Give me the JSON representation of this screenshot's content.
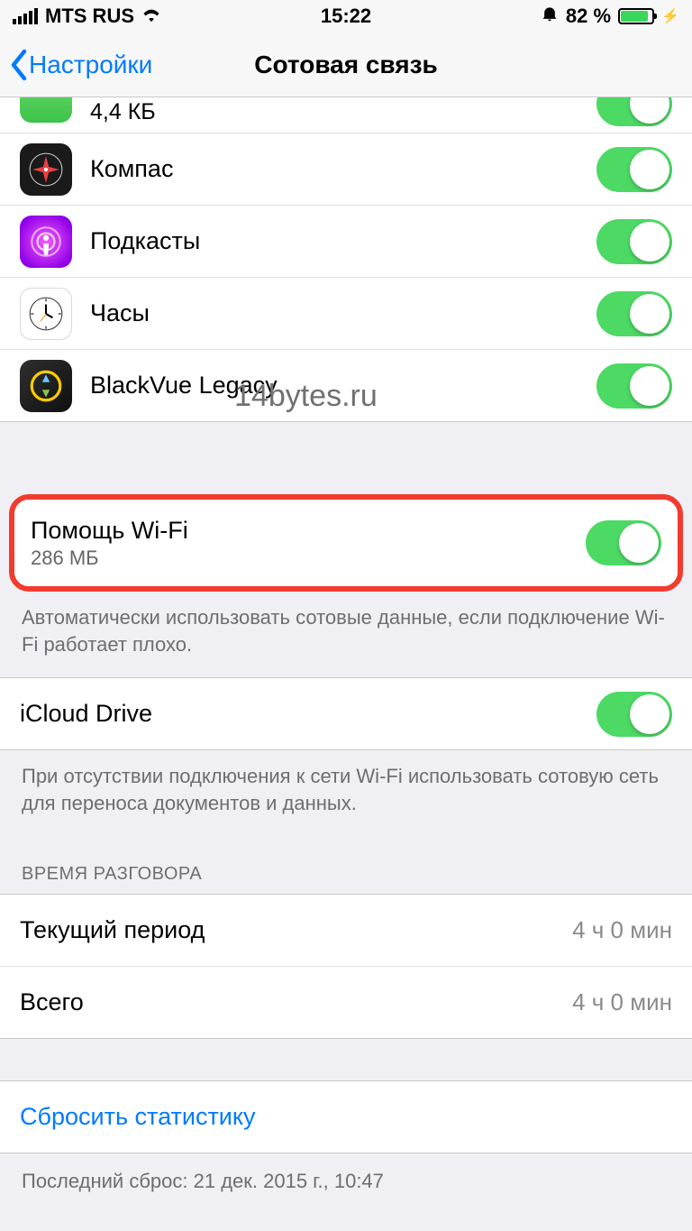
{
  "status": {
    "carrier": "MTS RUS",
    "time": "15:22",
    "battery_pct": "82 %",
    "charge_glyph": "⚡"
  },
  "nav": {
    "back": "Настройки",
    "title": "Сотовая связь"
  },
  "apps_partial": {
    "sub": "4,4 КБ"
  },
  "apps": [
    {
      "name": "Компас",
      "icon": "compass"
    },
    {
      "name": "Подкасты",
      "icon": "podcasts"
    },
    {
      "name": "Часы",
      "icon": "clock"
    },
    {
      "name": "BlackVue Legacy",
      "icon": "blackvue"
    }
  ],
  "wifi_assist": {
    "title": "Помощь Wi-Fi",
    "usage": "286 МБ"
  },
  "wifi_assist_footer": "Автоматически использовать сотовые данные, если подключение Wi-Fi работает плохо.",
  "icloud": {
    "title": "iCloud Drive"
  },
  "icloud_footer": "При отсутствии подключения к сети Wi-Fi использовать сотовую сеть для переноса документов и данных.",
  "call_time_header": "ВРЕМЯ РАЗГОВОРА",
  "call_time": [
    {
      "label": "Текущий период",
      "value": "4 ч 0 мин"
    },
    {
      "label": "Всего",
      "value": "4 ч 0 мин"
    }
  ],
  "reset": "Сбросить статистику",
  "last_reset": "Последний сброс: 21 дек. 2015 г., 10:47",
  "watermark": "14bytes.ru"
}
